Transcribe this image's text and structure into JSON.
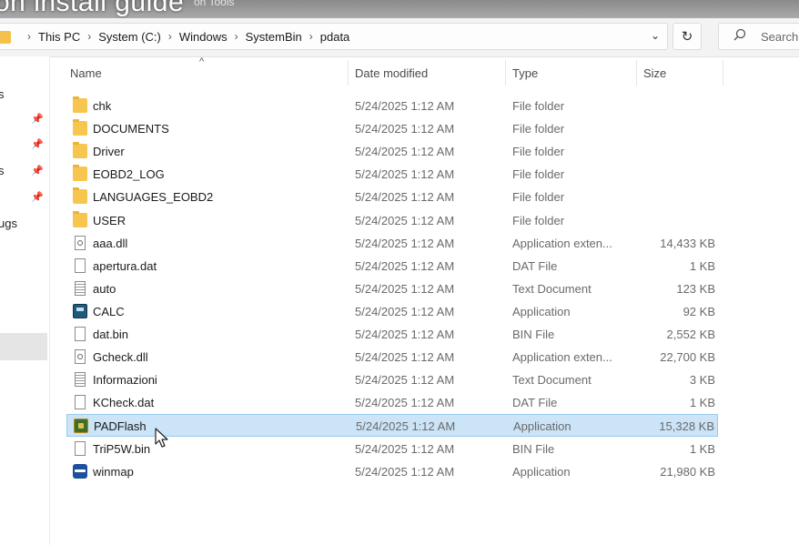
{
  "overlay": {
    "title_fragment": "on install guide",
    "ghost_text": "on Tools"
  },
  "breadcrumb": {
    "items": [
      "This PC",
      "System (C:)",
      "Windows",
      "SystemBin",
      "pdata"
    ],
    "separator": "›"
  },
  "search": {
    "placeholder": "Search"
  },
  "navpane": {
    "fragments": [
      "s",
      "s",
      "ugs"
    ]
  },
  "columns": {
    "name": "Name",
    "date": "Date modified",
    "type": "Type",
    "size": "Size"
  },
  "files": [
    {
      "name": "chk",
      "date": "5/24/2025 1:12 AM",
      "type": "File folder",
      "size": "",
      "icon": "folder-icon"
    },
    {
      "name": "DOCUMENTS",
      "date": "5/24/2025 1:12 AM",
      "type": "File folder",
      "size": "",
      "icon": "folder-icon"
    },
    {
      "name": "Driver",
      "date": "5/24/2025 1:12 AM",
      "type": "File folder",
      "size": "",
      "icon": "folder-icon"
    },
    {
      "name": "EOBD2_LOG",
      "date": "5/24/2025 1:12 AM",
      "type": "File folder",
      "size": "",
      "icon": "folder-icon"
    },
    {
      "name": "LANGUAGES_EOBD2",
      "date": "5/24/2025 1:12 AM",
      "type": "File folder",
      "size": "",
      "icon": "folder-icon"
    },
    {
      "name": "USER",
      "date": "5/24/2025 1:12 AM",
      "type": "File folder",
      "size": "",
      "icon": "folder-icon"
    },
    {
      "name": "aaa.dll",
      "date": "5/24/2025 1:12 AM",
      "type": "Application exten...",
      "size": "14,433 KB",
      "icon": "dll-file-icon"
    },
    {
      "name": "apertura.dat",
      "date": "5/24/2025 1:12 AM",
      "type": "DAT File",
      "size": "1 KB",
      "icon": "blank-file-icon"
    },
    {
      "name": "auto",
      "date": "5/24/2025 1:12 AM",
      "type": "Text Document",
      "size": "123 KB",
      "icon": "text-file-icon"
    },
    {
      "name": "CALC",
      "date": "5/24/2025 1:12 AM",
      "type": "Application",
      "size": "92 KB",
      "icon": "calc-app-icon"
    },
    {
      "name": "dat.bin",
      "date": "5/24/2025 1:12 AM",
      "type": "BIN File",
      "size": "2,552 KB",
      "icon": "blank-file-icon"
    },
    {
      "name": "Gcheck.dll",
      "date": "5/24/2025 1:12 AM",
      "type": "Application exten...",
      "size": "22,700 KB",
      "icon": "dll-file-icon"
    },
    {
      "name": "Informazioni",
      "date": "5/24/2025 1:12 AM",
      "type": "Text Document",
      "size": "3 KB",
      "icon": "text-file-icon"
    },
    {
      "name": "KCheck.dat",
      "date": "5/24/2025 1:12 AM",
      "type": "DAT File",
      "size": "1 KB",
      "icon": "blank-file-icon"
    },
    {
      "name": "PADFlash",
      "date": "5/24/2025 1:12 AM",
      "type": "Application",
      "size": "15,328 KB",
      "icon": "padflash-app-icon",
      "selected": true
    },
    {
      "name": "TriP5W.bin",
      "date": "5/24/2025 1:12 AM",
      "type": "BIN File",
      "size": "1 KB",
      "icon": "blank-file-icon"
    },
    {
      "name": "winmap",
      "date": "5/24/2025 1:12 AM",
      "type": "Application",
      "size": "21,980 KB",
      "icon": "winmap-app-icon"
    }
  ],
  "colors": {
    "selection": "#cce4f7",
    "folder": "#f6c64e"
  }
}
